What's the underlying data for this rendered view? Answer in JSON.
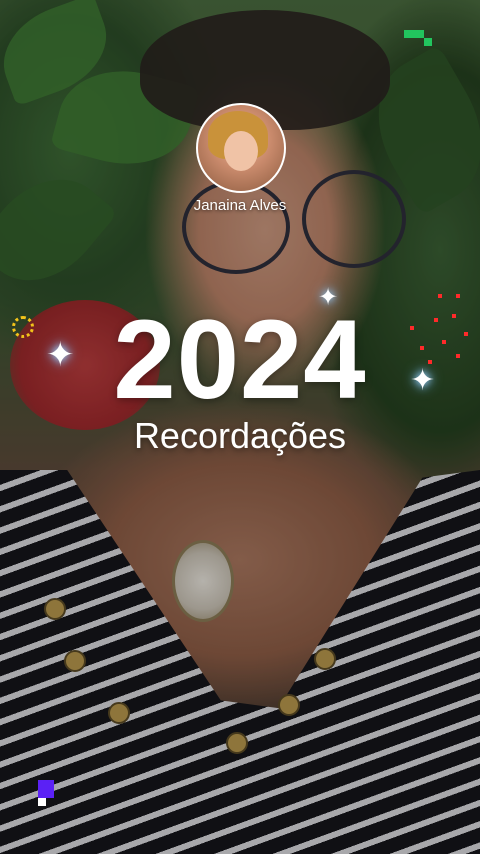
{
  "profile": {
    "name": "Janaina Alves",
    "avatar_icon": "profile-photo"
  },
  "title": {
    "year": "2024",
    "subtitle": "Recordações"
  },
  "decorations": {
    "sparkle_glyph": "✦",
    "accent_green": "#22c55e",
    "accent_purple": "#5b21f5"
  }
}
